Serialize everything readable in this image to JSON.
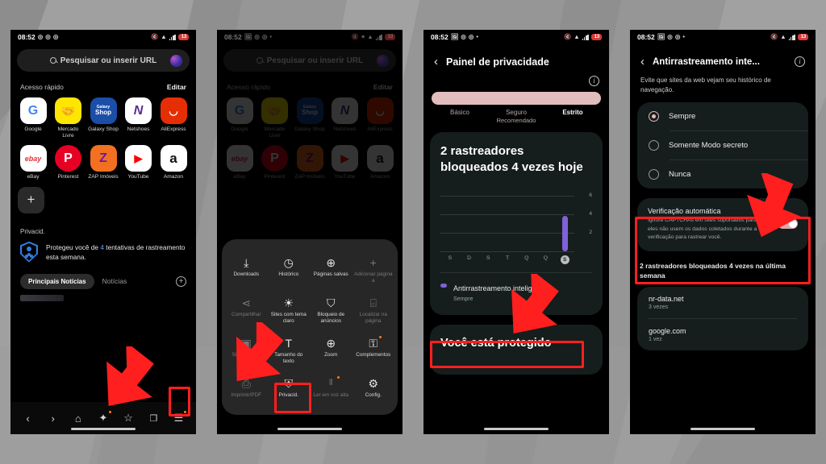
{
  "panels": {
    "p1": {
      "status": {
        "time": "08:52",
        "battery": "13"
      },
      "search": {
        "placeholder": "Pesquisar ou inserir URL"
      },
      "quick": {
        "title": "Acesso rápido",
        "edit": "Editar"
      },
      "apps_row1": [
        {
          "name": "Google",
          "glyph": "G",
          "bg": "#ffffff",
          "fg": "#4285f4"
        },
        {
          "name": "Mercado Livre",
          "glyph": "🤝",
          "bg": "#ffe600",
          "fg": "#2d3277"
        },
        {
          "name": "Galaxy Shop",
          "glyph": "Shop",
          "bg": "#1a4ea8",
          "fg": "#ffffff"
        },
        {
          "name": "Netshoes",
          "glyph": "N",
          "bg": "#ffffff",
          "fg": "#5b2d8e"
        },
        {
          "name": "AliExpress",
          "glyph": "◡",
          "bg": "#e62e04",
          "fg": "#ffffff"
        }
      ],
      "apps_row2": [
        {
          "name": "eBay",
          "glyph": "ebay",
          "bg": "#ffffff",
          "fg": "#e53238"
        },
        {
          "name": "Pinterest",
          "glyph": "P",
          "bg": "#e60023",
          "fg": "#ffffff"
        },
        {
          "name": "ZAP Imóveis",
          "glyph": "Z",
          "bg": "#f37021",
          "fg": "#6a1b9a"
        },
        {
          "name": "YouTube",
          "glyph": "▶",
          "bg": "#ffffff",
          "fg": "#ff0000"
        },
        {
          "name": "Amazon",
          "glyph": "a",
          "bg": "#ffffff",
          "fg": "#111111"
        }
      ],
      "add_label": "+",
      "privacy": {
        "label": "Privacid.",
        "text_before": "Protegeu você de ",
        "count": "4",
        "text_after": " tentativas de rastreamento esta semana."
      },
      "news": {
        "tab_active": "Principais Notícias",
        "tab_other": "Notícias",
        "add": "+"
      }
    },
    "p2": {
      "menu": [
        [
          {
            "label": "Downloads",
            "icon": "download-icon",
            "glyph": "⤓",
            "dim": false,
            "dot": false
          },
          {
            "label": "Histórico",
            "icon": "clock-icon",
            "glyph": "◷",
            "dim": false,
            "dot": false
          },
          {
            "label": "Páginas salvas",
            "icon": "globe-icon",
            "glyph": "⊕",
            "dim": false,
            "dot": false
          },
          {
            "label": "Adicionar página a",
            "icon": "plus-icon",
            "glyph": "+",
            "dim": true,
            "dot": false
          }
        ],
        [
          {
            "label": "Compartilhar",
            "icon": "share-icon",
            "glyph": "⋖",
            "dim": true,
            "dot": false
          },
          {
            "label": "Sites com tema claro",
            "icon": "sun-icon",
            "glyph": "☀",
            "dim": false,
            "dot": false
          },
          {
            "label": "Bloqueio de anúncios",
            "icon": "shield-block-icon",
            "glyph": "⃠",
            "dim": false,
            "dot": false
          },
          {
            "label": "Localizar na página",
            "icon": "find-page-icon",
            "glyph": "⌕",
            "dim": true,
            "dot": false
          }
        ],
        [
          {
            "label": "Site desktop",
            "icon": "desktop-icon",
            "glyph": "🖥",
            "dim": true,
            "dot": false
          },
          {
            "label": "Tamanho do texto",
            "icon": "text-size-icon",
            "glyph": "T",
            "dim": false,
            "dot": false
          },
          {
            "label": "Zoom",
            "icon": "zoom-icon",
            "glyph": "⊕",
            "dim": false,
            "dot": false
          },
          {
            "label": "Complementos",
            "icon": "addons-icon",
            "glyph": "⚲",
            "dim": false,
            "dot": true
          }
        ],
        [
          {
            "label": "Imprimir/PDF",
            "icon": "printer-icon",
            "glyph": "⎙",
            "dim": true,
            "dot": false
          },
          {
            "label": "Privacid.",
            "icon": "privacy-shield-icon",
            "glyph": "⛨",
            "dim": false,
            "dot": false
          },
          {
            "label": "Ler em voz alta",
            "icon": "read-aloud-icon",
            "glyph": "⁝|⁝",
            "dim": true,
            "dot": true
          },
          {
            "label": "Config.",
            "icon": "gear-icon",
            "glyph": "⚙",
            "dim": false,
            "dot": false
          }
        ]
      ]
    },
    "p3": {
      "title": "Painel de privacidade",
      "levels": [
        {
          "label": "Básico",
          "sub": ""
        },
        {
          "label": "Seguro",
          "sub": "Recomendado"
        },
        {
          "label": "Estrito",
          "sub": ""
        }
      ],
      "active_level": "Estrito",
      "card_heading": "2 rastreadores bloqueados 4 vezes hoje",
      "item": {
        "title": "Antirrastreamento inteligente",
        "sub": "Sempre"
      },
      "card2_heading": "Você está protegido"
    },
    "p4": {
      "title": "Antirrastreamento inte...",
      "desc": "Evite que sites da web vejam seu histórico de navegação.",
      "options": [
        {
          "label": "Sempre",
          "selected": true
        },
        {
          "label": "Somente Modo secreto",
          "selected": false
        },
        {
          "label": "Nunca",
          "selected": false
        }
      ],
      "auto": {
        "title": "Verificação automática",
        "sub": "Ignore CAPTCHAs em sites suportados para que eles não usem os dados coletados durante a verificação para rastrear você.",
        "toggle_on": true
      },
      "summary": "2 rastreadores bloqueados 4 vezes na última semana",
      "trackers": [
        {
          "domain": "nr-data.net",
          "count": "3 vezes"
        },
        {
          "domain": "google.com",
          "count": "1 vez"
        }
      ]
    }
  },
  "chart_data": {
    "type": "bar",
    "title": "2 rastreadores bloqueados 4 vezes hoje",
    "categories": [
      "S",
      "D",
      "S",
      "T",
      "Q",
      "Q",
      "S"
    ],
    "values": [
      0,
      0,
      0,
      0,
      0,
      0,
      4
    ],
    "ylabel": "",
    "xlabel": "",
    "ylim": [
      0,
      7
    ],
    "yticks": [
      "6",
      "4",
      "2"
    ],
    "grid": true,
    "bar_color": "#7f62d8",
    "highlight_category": "S"
  },
  "colors": {
    "highlight": "#ff1f1f",
    "accent_purple": "#7f62d8",
    "accent_pink": "#e2bdbd",
    "blue_link": "#5aa9ff"
  }
}
